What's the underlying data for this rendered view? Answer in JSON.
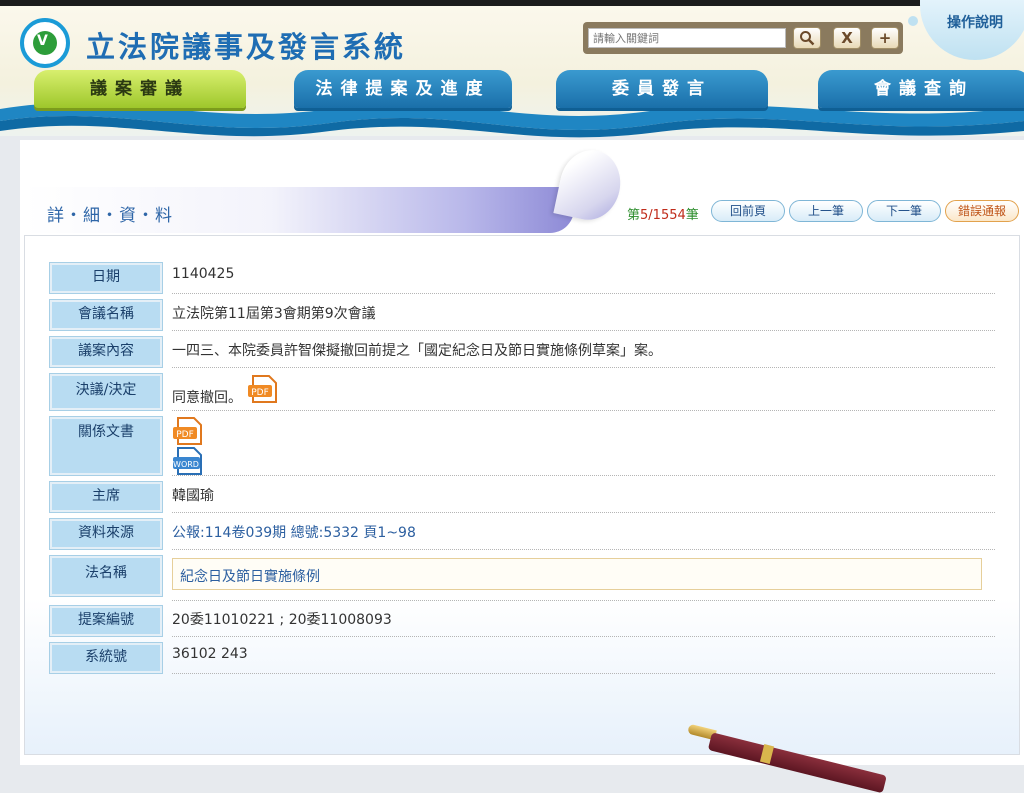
{
  "header": {
    "site_title": "立法院議事及發言系統",
    "search_placeholder": "請輸入關鍵詞",
    "help_label": "操作說明",
    "search_btn_glyph": "🔍",
    "clear_btn_glyph": "X",
    "add_btn_glyph": "+"
  },
  "nav": [
    {
      "label": "議案審議",
      "active": true
    },
    {
      "label": "法律提案及進度",
      "active": false
    },
    {
      "label": "委員發言",
      "active": false
    },
    {
      "label": "會議查詢",
      "active": false
    }
  ],
  "detail": {
    "title": "詳・細・資・料",
    "pagination_prefix": "第",
    "pagination_current": "5/1554",
    "pagination_suffix": "筆",
    "buttons": {
      "back": "回前頁",
      "prev": "上一筆",
      "next": "下一筆",
      "report": "錯誤通報"
    }
  },
  "record": {
    "date_label": "日期",
    "date": "1140425",
    "meeting_label": "會議名稱",
    "meeting": "立法院第11屆第3會期第9次會議",
    "content_label": "議案內容",
    "content": "一四三、本院委員許智傑擬撤回前提之「國定紀念日及節日實施條例草案」案。",
    "resolution_label": "決議/決定",
    "resolution": "同意撤回。",
    "docs_label": "關係文書",
    "chair_label": "主席",
    "chair": "韓國瑜",
    "source_label": "資料來源",
    "source": "公報:114卷039期 總號:5332 頁1~98",
    "law_label": "法名稱",
    "law": "紀念日及節日實施條例",
    "proposal_label": "提案編號",
    "proposal": "20委11010221 ; 20委11008093",
    "system_label": "系統號",
    "system": "36102 243"
  },
  "icons": {
    "pdf_text": "PDF",
    "word_text": "WORD"
  },
  "colors": {
    "accent_blue": "#1f6db3",
    "nav_active": "#a9cf33",
    "label_bg": "#b8dcf2"
  }
}
